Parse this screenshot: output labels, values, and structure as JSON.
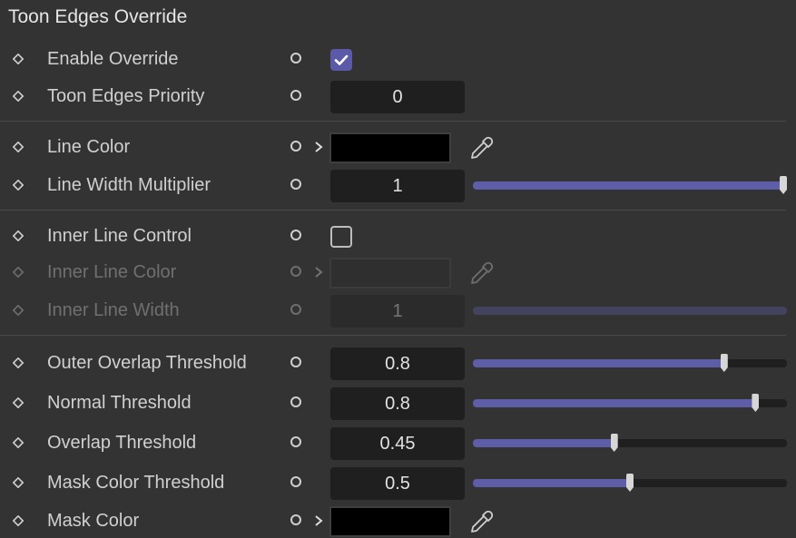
{
  "panel": {
    "title": "Toon Edges Override"
  },
  "rows": {
    "enable_override": {
      "label": "Enable Override",
      "checked": true
    },
    "toon_edges_priority": {
      "label": "Toon Edges Priority",
      "value": "0"
    },
    "line_color": {
      "label": "Line Color",
      "color": "#000000"
    },
    "line_width_multiplier": {
      "label": "Line Width Multiplier",
      "value": "1",
      "slider_fraction": 1.0
    },
    "inner_line_control": {
      "label": "Inner Line Control",
      "checked": false
    },
    "inner_line_color": {
      "label": "Inner Line Color",
      "disabled": true
    },
    "inner_line_width": {
      "label": "Inner Line Width",
      "value": "1",
      "slider_fraction": 1.0,
      "disabled": true
    },
    "outer_overlap_threshold": {
      "label": "Outer Overlap Threshold",
      "value": "0.8",
      "slider_fraction": 0.8
    },
    "normal_threshold": {
      "label": "Normal Threshold",
      "value": "0.8",
      "slider_fraction": 0.9
    },
    "overlap_threshold": {
      "label": "Overlap Threshold",
      "value": "0.45",
      "slider_fraction": 0.45
    },
    "mask_color_threshold": {
      "label": "Mask Color Threshold",
      "value": "0.5",
      "slider_fraction": 0.5
    },
    "mask_color": {
      "label": "Mask Color",
      "color": "#000000"
    }
  },
  "colors": {
    "accent": "#5d5da8",
    "background": "#333333",
    "field": "#1f1f1f"
  },
  "icons": [
    "keyframe-diamond-icon",
    "animate-circle-icon",
    "chevron-right-icon",
    "eyedropper-icon",
    "checkmark-icon"
  ]
}
